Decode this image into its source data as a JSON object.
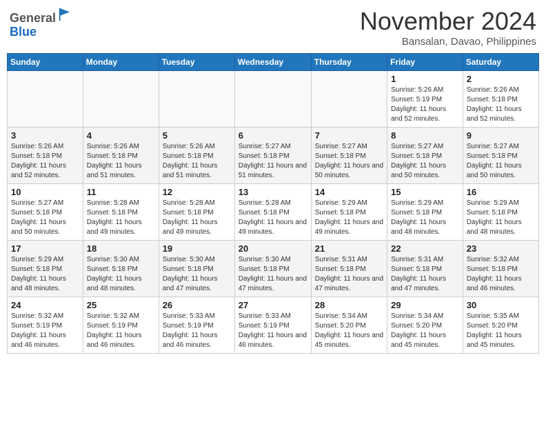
{
  "header": {
    "logo_line1": "General",
    "logo_line2": "Blue",
    "month": "November 2024",
    "location": "Bansalan, Davao, Philippines"
  },
  "days_of_week": [
    "Sunday",
    "Monday",
    "Tuesday",
    "Wednesday",
    "Thursday",
    "Friday",
    "Saturday"
  ],
  "weeks": [
    [
      {
        "day": "",
        "info": ""
      },
      {
        "day": "",
        "info": ""
      },
      {
        "day": "",
        "info": ""
      },
      {
        "day": "",
        "info": ""
      },
      {
        "day": "",
        "info": ""
      },
      {
        "day": "1",
        "info": "Sunrise: 5:26 AM\nSunset: 5:19 PM\nDaylight: 11 hours and 52 minutes."
      },
      {
        "day": "2",
        "info": "Sunrise: 5:26 AM\nSunset: 5:18 PM\nDaylight: 11 hours and 52 minutes."
      }
    ],
    [
      {
        "day": "3",
        "info": "Sunrise: 5:26 AM\nSunset: 5:18 PM\nDaylight: 11 hours and 52 minutes."
      },
      {
        "day": "4",
        "info": "Sunrise: 5:26 AM\nSunset: 5:18 PM\nDaylight: 11 hours and 51 minutes."
      },
      {
        "day": "5",
        "info": "Sunrise: 5:26 AM\nSunset: 5:18 PM\nDaylight: 11 hours and 51 minutes."
      },
      {
        "day": "6",
        "info": "Sunrise: 5:27 AM\nSunset: 5:18 PM\nDaylight: 11 hours and 51 minutes."
      },
      {
        "day": "7",
        "info": "Sunrise: 5:27 AM\nSunset: 5:18 PM\nDaylight: 11 hours and 50 minutes."
      },
      {
        "day": "8",
        "info": "Sunrise: 5:27 AM\nSunset: 5:18 PM\nDaylight: 11 hours and 50 minutes."
      },
      {
        "day": "9",
        "info": "Sunrise: 5:27 AM\nSunset: 5:18 PM\nDaylight: 11 hours and 50 minutes."
      }
    ],
    [
      {
        "day": "10",
        "info": "Sunrise: 5:27 AM\nSunset: 5:18 PM\nDaylight: 11 hours and 50 minutes."
      },
      {
        "day": "11",
        "info": "Sunrise: 5:28 AM\nSunset: 5:18 PM\nDaylight: 11 hours and 49 minutes."
      },
      {
        "day": "12",
        "info": "Sunrise: 5:28 AM\nSunset: 5:18 PM\nDaylight: 11 hours and 49 minutes."
      },
      {
        "day": "13",
        "info": "Sunrise: 5:28 AM\nSunset: 5:18 PM\nDaylight: 11 hours and 49 minutes."
      },
      {
        "day": "14",
        "info": "Sunrise: 5:29 AM\nSunset: 5:18 PM\nDaylight: 11 hours and 49 minutes."
      },
      {
        "day": "15",
        "info": "Sunrise: 5:29 AM\nSunset: 5:18 PM\nDaylight: 11 hours and 48 minutes."
      },
      {
        "day": "16",
        "info": "Sunrise: 5:29 AM\nSunset: 5:18 PM\nDaylight: 11 hours and 48 minutes."
      }
    ],
    [
      {
        "day": "17",
        "info": "Sunrise: 5:29 AM\nSunset: 5:18 PM\nDaylight: 11 hours and 48 minutes."
      },
      {
        "day": "18",
        "info": "Sunrise: 5:30 AM\nSunset: 5:18 PM\nDaylight: 11 hours and 48 minutes."
      },
      {
        "day": "19",
        "info": "Sunrise: 5:30 AM\nSunset: 5:18 PM\nDaylight: 11 hours and 47 minutes."
      },
      {
        "day": "20",
        "info": "Sunrise: 5:30 AM\nSunset: 5:18 PM\nDaylight: 11 hours and 47 minutes."
      },
      {
        "day": "21",
        "info": "Sunrise: 5:31 AM\nSunset: 5:18 PM\nDaylight: 11 hours and 47 minutes."
      },
      {
        "day": "22",
        "info": "Sunrise: 5:31 AM\nSunset: 5:18 PM\nDaylight: 11 hours and 47 minutes."
      },
      {
        "day": "23",
        "info": "Sunrise: 5:32 AM\nSunset: 5:18 PM\nDaylight: 11 hours and 46 minutes."
      }
    ],
    [
      {
        "day": "24",
        "info": "Sunrise: 5:32 AM\nSunset: 5:19 PM\nDaylight: 11 hours and 46 minutes."
      },
      {
        "day": "25",
        "info": "Sunrise: 5:32 AM\nSunset: 5:19 PM\nDaylight: 11 hours and 46 minutes."
      },
      {
        "day": "26",
        "info": "Sunrise: 5:33 AM\nSunset: 5:19 PM\nDaylight: 11 hours and 46 minutes."
      },
      {
        "day": "27",
        "info": "Sunrise: 5:33 AM\nSunset: 5:19 PM\nDaylight: 11 hours and 46 minutes."
      },
      {
        "day": "28",
        "info": "Sunrise: 5:34 AM\nSunset: 5:20 PM\nDaylight: 11 hours and 45 minutes."
      },
      {
        "day": "29",
        "info": "Sunrise: 5:34 AM\nSunset: 5:20 PM\nDaylight: 11 hours and 45 minutes."
      },
      {
        "day": "30",
        "info": "Sunrise: 5:35 AM\nSunset: 5:20 PM\nDaylight: 11 hours and 45 minutes."
      }
    ]
  ]
}
